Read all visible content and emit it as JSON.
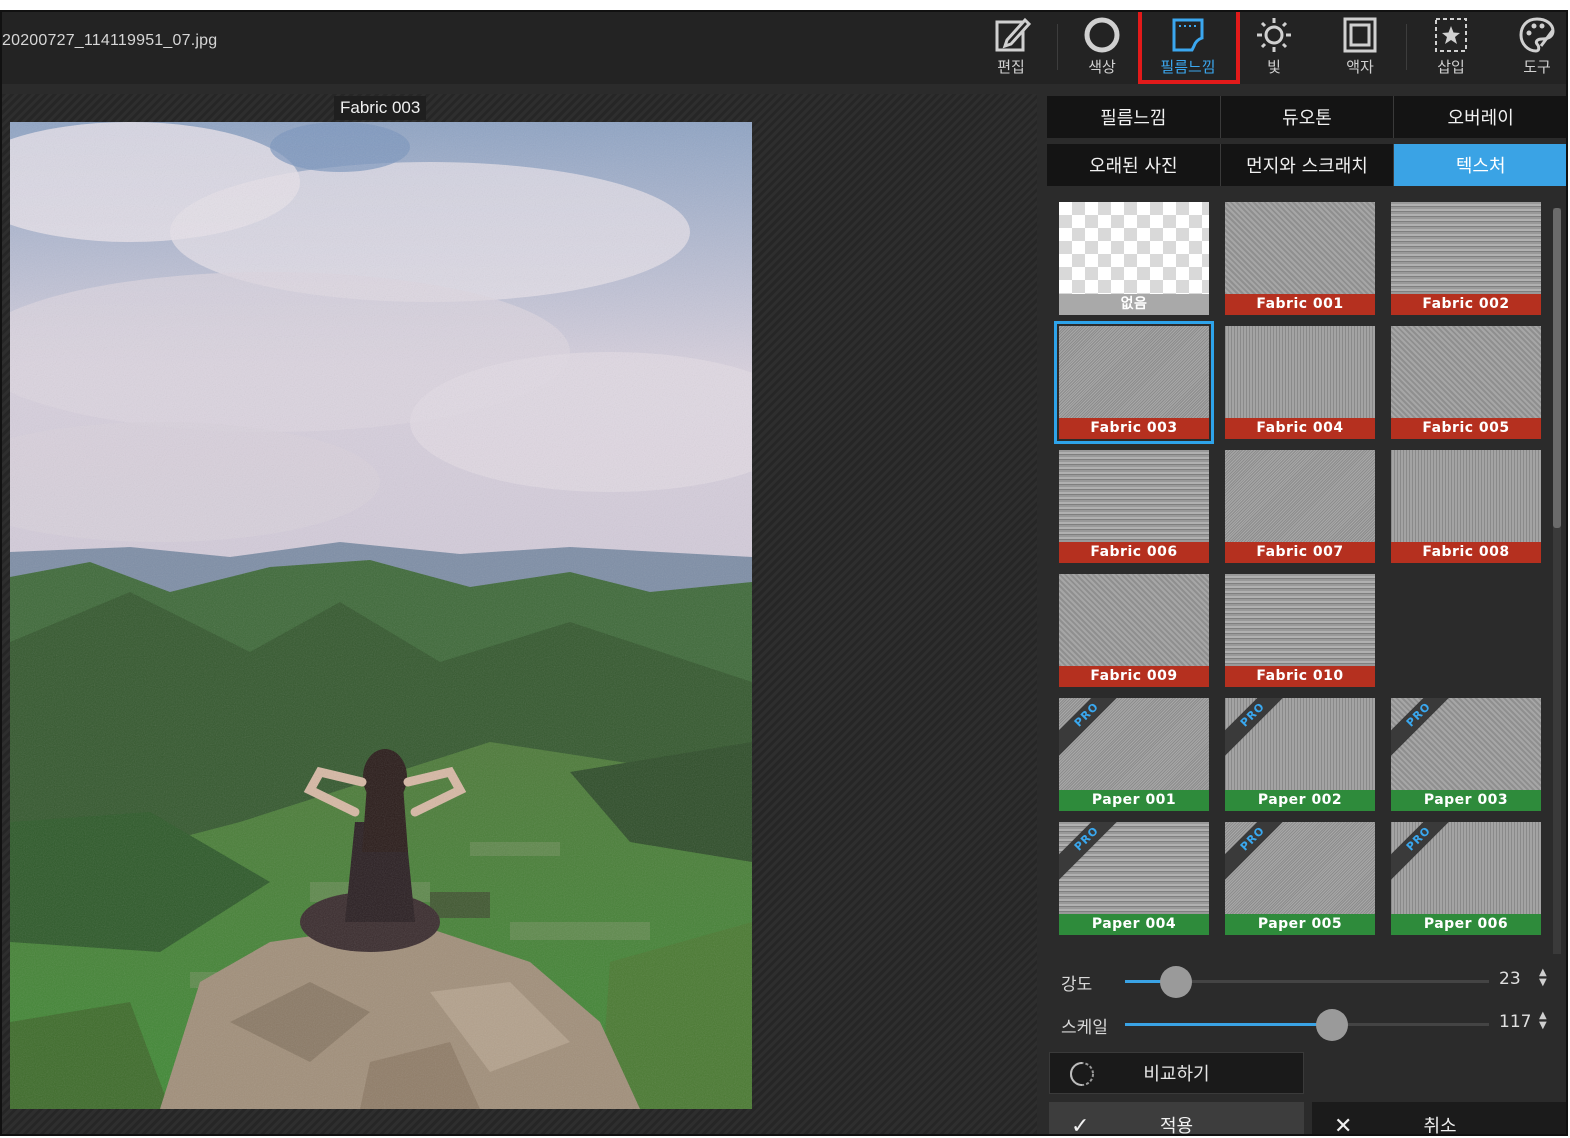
{
  "header": {
    "filename": "20200727_114119951_07.jpg",
    "tools": [
      {
        "label": "편집",
        "icon": "edit-icon"
      },
      {
        "label": "색상",
        "icon": "color-circle-icon"
      },
      {
        "label": "필름느낌",
        "icon": "film-icon"
      },
      {
        "label": "빛",
        "icon": "light-icon"
      },
      {
        "label": "액자",
        "icon": "frame-icon"
      },
      {
        "label": "삽입",
        "icon": "insert-icon"
      },
      {
        "label": "도구",
        "icon": "palette-icon"
      }
    ],
    "active_tool": "필름느낌",
    "accent": "#3aa3e5",
    "highlight_color": "#e21a1a"
  },
  "preview": {
    "label": "Fabric 003"
  },
  "panel": {
    "tabs_row1": [
      "필름느낌",
      "듀오톤",
      "오버레이"
    ],
    "tabs_row2": [
      "오래된 사진",
      "먼지와 스크래치",
      "텍스처"
    ],
    "selected_tab": "텍스처",
    "textures": [
      {
        "label": "없음",
        "kind": "none"
      },
      {
        "label": "Fabric 001",
        "kind": "fabric"
      },
      {
        "label": "Fabric 002",
        "kind": "fabric"
      },
      {
        "label": "Fabric 003",
        "kind": "fabric",
        "selected": true
      },
      {
        "label": "Fabric 004",
        "kind": "fabric"
      },
      {
        "label": "Fabric 005",
        "kind": "fabric"
      },
      {
        "label": "Fabric 006",
        "kind": "fabric"
      },
      {
        "label": "Fabric 007",
        "kind": "fabric"
      },
      {
        "label": "Fabric 008",
        "kind": "fabric"
      },
      {
        "label": "Fabric 009",
        "kind": "fabric"
      },
      {
        "label": "Fabric 010",
        "kind": "fabric"
      },
      {
        "label": "Paper 001",
        "kind": "paper",
        "pro": "PRO"
      },
      {
        "label": "Paper 002",
        "kind": "paper",
        "pro": "PRO"
      },
      {
        "label": "Paper 003",
        "kind": "paper",
        "pro": "PRO"
      },
      {
        "label": "Paper 004",
        "kind": "paper",
        "pro": "PRO"
      },
      {
        "label": "Paper 005",
        "kind": "paper",
        "pro": "PRO"
      },
      {
        "label": "Paper 006",
        "kind": "paper",
        "pro": "PRO"
      }
    ],
    "sliders": [
      {
        "label": "강도",
        "value": "23",
        "fraction": 0.14
      },
      {
        "label": "스케일",
        "value": "117",
        "fraction": 0.57
      }
    ],
    "compare_label": "비교하기",
    "apply_label": "적용",
    "cancel_label": "취소"
  }
}
